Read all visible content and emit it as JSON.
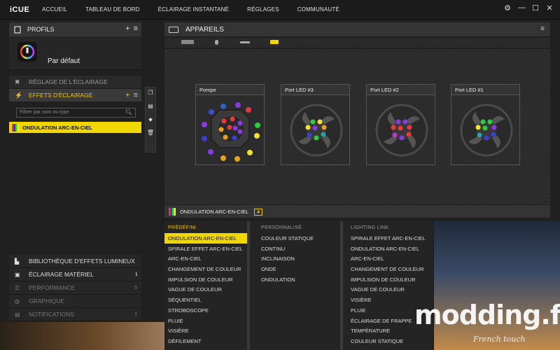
{
  "app": {
    "logo": "iCUE"
  },
  "nav": [
    "ACCUEIL",
    "TABLEAU DE BORD",
    "ÉCLAIRAGE INSTANTANÉ",
    "RÉGLAGES",
    "COMMUNAUTÉ"
  ],
  "window_controls": [
    "⚙",
    "—",
    "☐",
    "✕"
  ],
  "left": {
    "profiles_header": "PROFILS",
    "profile_name": "Par défaut",
    "lighting_setup": "RÉGLAGE DE L'ÉCLAIRAGE",
    "lighting_effects": "EFFETS D'ÉCLAIRAGE",
    "filter_placeholder": "Filtrer par nom ou type",
    "selected_effect": "ONDULATION ARC-EN-CIEL",
    "library": "BIBLIOTHÈQUE D'EFFETS LUMINEUX",
    "hardware_lighting": "ÉCLAIRAGE MATÉRIEL",
    "performance": "PERFORMANCE",
    "performance_count": "5",
    "graphique": "GRAPHIQUE",
    "notifications": "NOTIFICATIONS",
    "notifications_count": "1"
  },
  "devices": {
    "header": "APPAREILS",
    "cards": [
      {
        "title": "Pompe"
      },
      {
        "title": "Port LED #3"
      },
      {
        "title": "Port LED #2"
      },
      {
        "title": "Port LED #1"
      }
    ]
  },
  "effect_bar": {
    "current": "ONDULATION ARC-EN-CIEL"
  },
  "dropdown": {
    "predefini_header": "PRÉDÉFINI",
    "predefini": [
      "ONDULATION ARC-EN-CIEL",
      "SPIRALE EFFET ARC-EN-CIEL",
      "ARC-EN-CIEL",
      "CHANGEMENT DE COULEUR",
      "IMPULSION DE COULEUR",
      "VAGUE DE COULEUR",
      "SÉQUENTIEL",
      "STROBOSCOPE",
      "PLUIE",
      "VISIÈRE",
      "DÉFILEMENT"
    ],
    "personnalise_header": "PERSONNALISÉ",
    "personnalise": [
      "COULEUR STATIQUE",
      "CONTINU",
      "INCLINAISON",
      "ONDE",
      "ONDULATION"
    ],
    "lighting_link_header": "LIGHTING LINK",
    "lighting_link": [
      "SPIRALE EFFET ARC-EN-CIEL",
      "ONDULATION ARC-EN-CIEL",
      "ARC-EN-CIEL",
      "CHANGEMENT DE COULEUR",
      "IMPULSION DE COULEUR",
      "VAGUE DE COULEUR",
      "VISIÈRE",
      "PLUIE",
      "ÉCLAIRAGE DE FRAPPE",
      "TEMPÉRATURE",
      "COULEUR STATIQUE"
    ]
  },
  "watermark": {
    "brand": "modding.fr",
    "tagline": "French touch"
  },
  "colors": {
    "accent": "#f2d600",
    "panel": "#343434",
    "background": "#202020"
  }
}
